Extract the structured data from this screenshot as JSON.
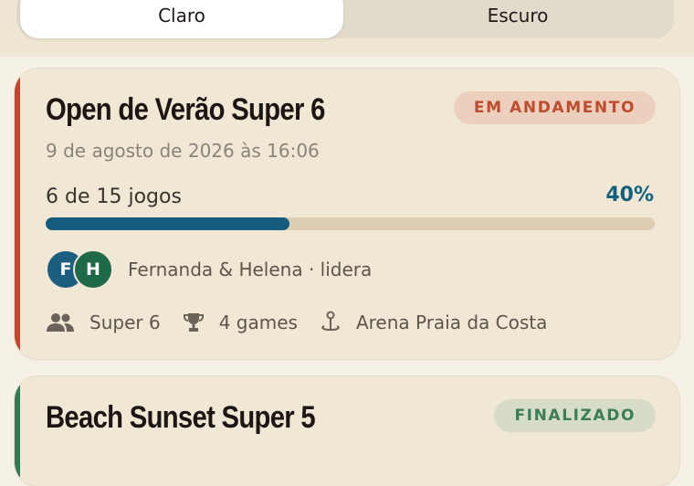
{
  "theme_toggle": {
    "light": "Claro",
    "dark": "Escuro"
  },
  "tournaments": [
    {
      "title": "Open de Verão Super 6",
      "status": "EM ANDAMENTO",
      "accent_color": "#c4462a",
      "date": "9 de agosto de 2026 às 16:06",
      "progress_text": "6 de 15 jogos",
      "progress_percent_text": "40%",
      "progress_fraction": 0.4,
      "leader_initials": [
        "F",
        "H"
      ],
      "leader_text": "Fernanda & Helena · lidera",
      "format": "Super 6",
      "games_per_match": "4 games",
      "venue": "Arena Praia da Costa"
    },
    {
      "title": "Beach Sunset Super 5",
      "status": "FINALIZADO",
      "accent_color": "#2f7a4f"
    }
  ],
  "icons": [
    "people-icon",
    "trophy-icon",
    "location-pin-icon"
  ]
}
